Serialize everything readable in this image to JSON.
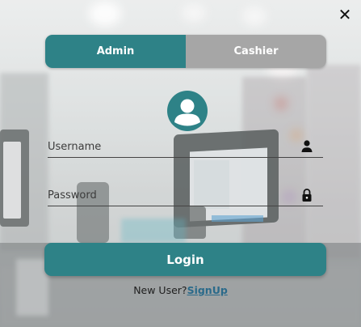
{
  "window": {
    "close_symbol": "✕",
    "close_icon": "close-icon"
  },
  "tabs": [
    {
      "label": "Admin",
      "active": true
    },
    {
      "label": "Cashier",
      "active": false
    }
  ],
  "avatar": {
    "icon": "user-avatar-icon"
  },
  "form": {
    "username_placeholder": "Username",
    "username_value": "",
    "username_icon": "person-icon",
    "password_placeholder": "Password",
    "password_value": "",
    "password_icon": "lock-icon"
  },
  "login": {
    "label": "Login"
  },
  "signup": {
    "prompt": "New User?",
    "link": "SignUp"
  },
  "colors": {
    "accent": "#2e8287",
    "inactive_tab": "#a6a6a6",
    "link": "#2a6a8a",
    "text": "#1e1e1e"
  }
}
